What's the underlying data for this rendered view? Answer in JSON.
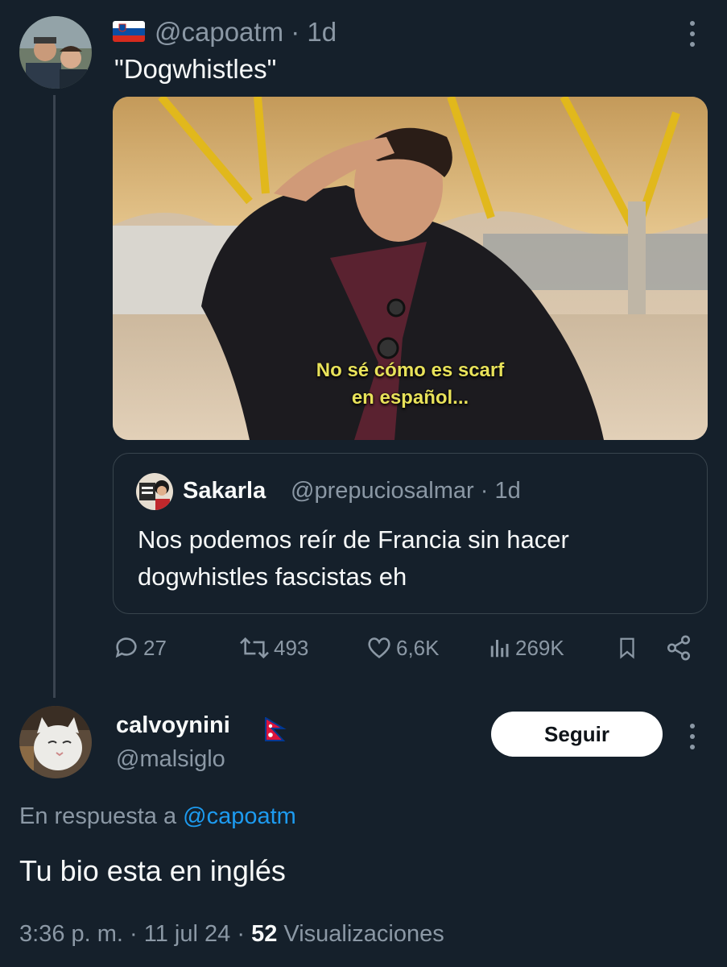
{
  "parent_tweet": {
    "handle": "@capoatm",
    "time": "1d",
    "separator": "·",
    "text": "\"Dogwhistles\"",
    "media_caption_line1": "No sé cómo es scarf",
    "media_caption_line2": "en español...",
    "quoted": {
      "name": "Sakarla",
      "handle": "@prepuciosalmar",
      "time": "1d",
      "text": "Nos podemos reír de Francia sin hacer dogwhistles fascistas eh"
    },
    "stats": {
      "replies": "27",
      "retweets": "493",
      "likes": "6,6K",
      "views": "269K"
    }
  },
  "reply_tweet": {
    "name": "calvoynini",
    "handle": "@malsiglo",
    "follow_label": "Seguir",
    "in_reply_prefix": "En respuesta a",
    "in_reply_handle": "@capoatm",
    "text": "Tu bio esta en inglés",
    "timestamp": "3:36 p. m.",
    "date": "11 jul 24",
    "views_count": "52",
    "views_label": "Visualizaciones"
  },
  "colors": {
    "background": "#15202b",
    "text": "#f7f9f9",
    "muted": "#8b98a5",
    "link": "#1d9bf0",
    "caption": "#e8e25a"
  },
  "icons": [
    "more-vertical-icon",
    "reply-icon",
    "retweet-icon",
    "like-icon",
    "views-icon",
    "bookmark-icon",
    "share-icon"
  ]
}
